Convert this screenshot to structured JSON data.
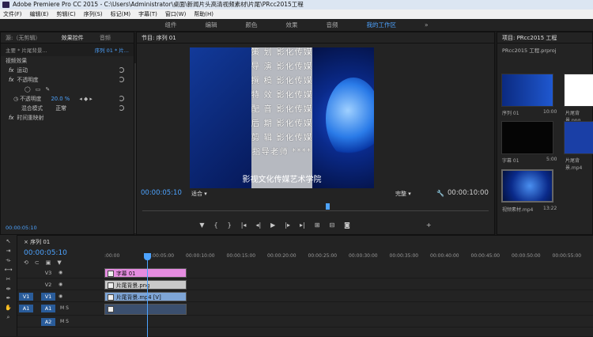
{
  "window": {
    "title": "Adobe Premiere Pro CC 2015 - C:\\Users\\Administrator\\桌面\\新闻片头高清视频素材\\片尾\\PRcc2015工程"
  },
  "menu": [
    "文件(F)",
    "编辑(E)",
    "剪辑(C)",
    "序列(S)",
    "标记(M)",
    "字幕(T)",
    "窗口(W)",
    "帮助(H)"
  ],
  "workspaces": [
    "组件",
    "编辑",
    "颜色",
    "效果",
    "音频",
    "我的工作区"
  ],
  "workspace_active": "我的工作区",
  "more_glyph": "»",
  "left_panel": {
    "tabs": [
      "源:（无剪辑）",
      "效果控件",
      "音频"
    ],
    "master": "主要 * 片尾背景...",
    "sequence": "序列 01 * 片...",
    "section": "视频效果",
    "motion": "运动",
    "opacity": "不透明度",
    "opacity_label": "不透明度",
    "opacity_value": "20.0 %",
    "blend_label": "混合模式",
    "blend_value": "正常",
    "time_remap": "时间重映射",
    "timecode": "00:00:05:10"
  },
  "monitor": {
    "tab": "节目: 序列 01",
    "timecode_left": "00:00:05:10",
    "fit": "适合",
    "quality": "完整",
    "timecode_right": "00:00:10:00",
    "credits": [
      "策 划 影化传媒",
      "导 演 影化传媒",
      "撰 稿 影化传媒",
      "特 效 影化传媒",
      "配 音 影化传媒",
      "后 期 影化传媒",
      "剪 辑 影化传媒",
      "指导老师 ****"
    ],
    "footer": "影视文化传媒艺术学院"
  },
  "project": {
    "tab": "项目: PRcc2015 工程",
    "file": "PRcc2015 工程.prproj",
    "items": [
      {
        "name": "序列 01",
        "dur": "10:00"
      },
      {
        "name": "片尾背景.png",
        "dur": ""
      },
      {
        "name": "字幕 01",
        "dur": "5:00"
      },
      {
        "name": "片尾背景.mp4",
        "dur": ""
      },
      {
        "name": "视频素材.mp4",
        "dur": "13:22"
      }
    ]
  },
  "timeline": {
    "tab": "序列 01",
    "timecode": "00:00:05:10",
    "ruler": [
      ":00:00",
      "00:00:05:00",
      "00:00:10:00",
      "00:00:15:00",
      "00:00:20:00",
      "00:00:25:00",
      "00:00:30:00",
      "00:00:35:00",
      "00:00:40:00",
      "00:00:45:00",
      "00:00:50:00",
      "00:00:55:00"
    ],
    "tracks": [
      {
        "id": "V3",
        "clip": "字幕 01"
      },
      {
        "id": "V2",
        "clip": "片尾背景.png"
      },
      {
        "id": "V1",
        "clip": "片尾背景.mp4 [V]"
      },
      {
        "id": "A1",
        "clip": ""
      },
      {
        "id": "A2",
        "clip": ""
      }
    ]
  },
  "colors": {
    "accent": "#4da3ff",
    "v3clip": "#e58ce0",
    "v2clip": "#c9c9c9",
    "v1clip": "#7ea5d6"
  }
}
